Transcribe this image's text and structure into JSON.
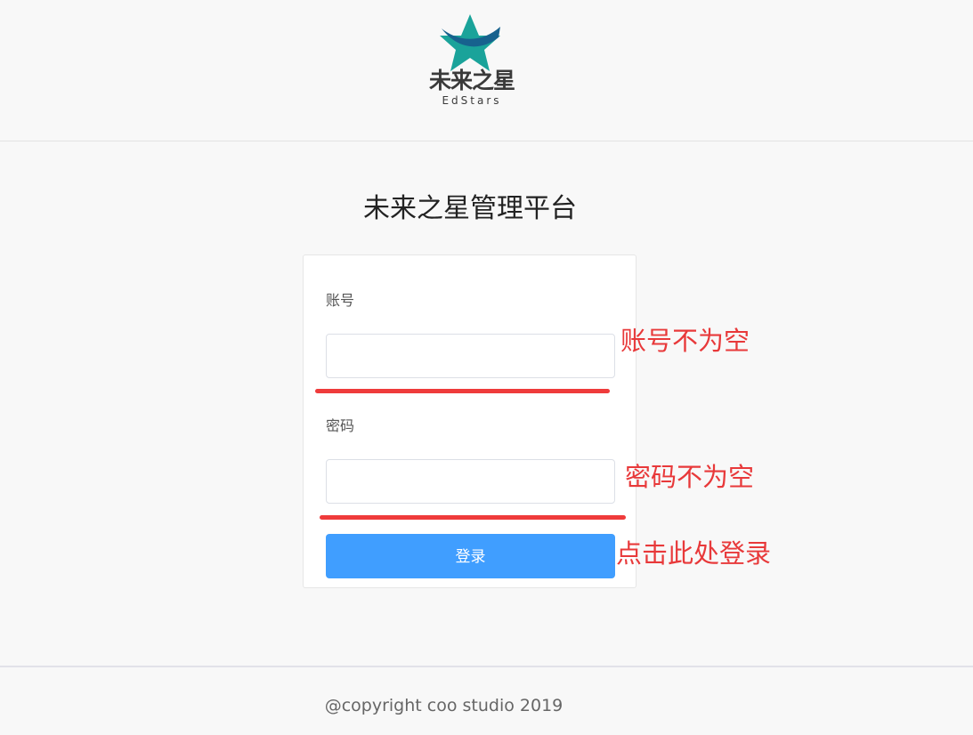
{
  "header": {
    "logo": {
      "name": "未来之星",
      "sub": "EdStars",
      "icon": "star-logo-icon",
      "colors": {
        "star": "#1aa39a",
        "swoosh": "#17628e"
      }
    }
  },
  "page_title": "未来之星管理平台",
  "form": {
    "account": {
      "label": "账号",
      "value": "",
      "placeholder": ""
    },
    "password": {
      "label": "密码",
      "value": "",
      "placeholder": ""
    },
    "submit_label": "登录",
    "button_color": "#409eff"
  },
  "annotations": {
    "account": "账号不为空",
    "password": "密码不为空",
    "login": "点击此处登录",
    "color": "#e8393a"
  },
  "footer": {
    "copyright": "@copyright coo studio 2019"
  }
}
